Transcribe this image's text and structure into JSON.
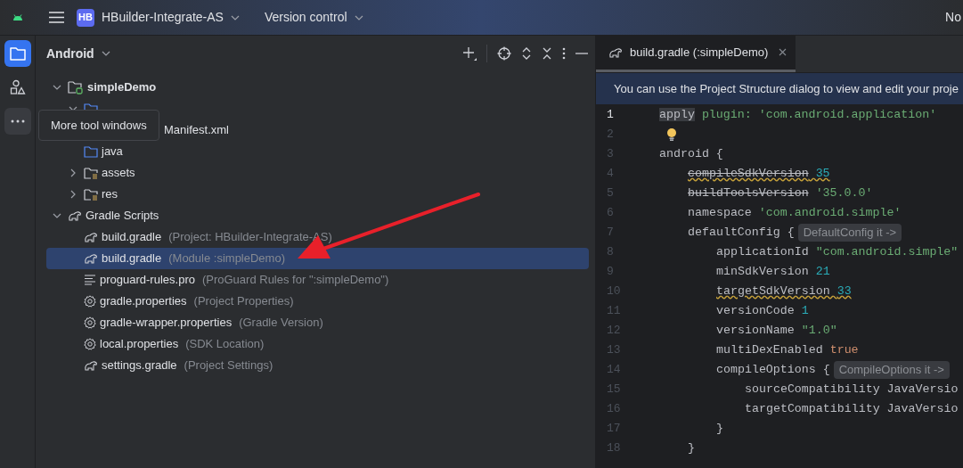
{
  "top_bar": {
    "project": {
      "badge": "HB",
      "name": "HBuilder-Integrate-AS"
    },
    "vcs": "Version control",
    "right_text": "No"
  },
  "tool_strip": [
    {
      "kind": "folder",
      "selected": true
    },
    {
      "kind": "shapes",
      "selected": false
    },
    {
      "kind": "more",
      "selected": false
    }
  ],
  "tooltip": "More tool windows",
  "project_panel": {
    "view": "Android",
    "tree": [
      {
        "label": "simpleDemo",
        "kind": "module",
        "expanded": true,
        "selected": false,
        "children": [
          {
            "kind": "folder",
            "expanded": true,
            "selected": false,
            "children": [
              {
                "label": "Manifest.xml",
                "kind": "partial",
                "selected": false
              }
            ]
          },
          {
            "label": "java",
            "kind": "folder",
            "selected": false
          },
          {
            "label": "assets",
            "kind": "resource",
            "expanded": false,
            "selected": false
          },
          {
            "label": "res",
            "kind": "resource",
            "expanded": false,
            "selected": false
          }
        ]
      },
      {
        "label": "Gradle Scripts",
        "kind": "gradle",
        "expanded": true,
        "selected": false,
        "children": [
          {
            "label": "build.gradle",
            "detail": "(Project: HBuilder-Integrate-AS)",
            "kind": "gradle",
            "selected": false
          },
          {
            "label": "build.gradle",
            "detail": "(Module :simpleDemo)",
            "kind": "gradle",
            "selected": true
          },
          {
            "label": "proguard-rules.pro",
            "detail": "(ProGuard Rules for \":simpleDemo\")",
            "kind": "text",
            "selected": false
          },
          {
            "label": "gradle.properties",
            "detail": "(Project Properties)",
            "kind": "properties",
            "selected": false
          },
          {
            "label": "gradle-wrapper.properties",
            "detail": "(Gradle Version)",
            "kind": "properties",
            "selected": false
          },
          {
            "label": "local.properties",
            "detail": "(SDK Location)",
            "kind": "properties",
            "selected": false
          },
          {
            "label": "settings.gradle",
            "detail": "(Project Settings)",
            "kind": "gradle",
            "selected": false
          }
        ]
      }
    ]
  },
  "editor": {
    "tabs": [
      {
        "label": "build.gradle (:simpleDemo)",
        "selected": true
      }
    ],
    "banner": "You can use the Project Structure dialog to view and edit your proje",
    "lines": [
      {
        "number": "1",
        "current": true,
        "tokens": [
          {
            "text": "apply",
            "kind": "highlight"
          },
          {
            "text": " plugin: 'com.android.application'",
            "kind": "string"
          }
        ]
      },
      {
        "number": "2",
        "current": false,
        "bulb": true
      },
      {
        "number": "3",
        "current": false,
        "tokens": [
          {
            "text": "android {",
            "kind": "plain"
          }
        ],
        "children": [
          {
            "number": "4",
            "current": false,
            "warning": true,
            "tokens": [
              {
                "text": "compileSdkVersion",
                "kind": "deprecated"
              },
              {
                "text": " 35",
                "kind": "number"
              }
            ]
          },
          {
            "number": "5",
            "current": false,
            "tokens": [
              {
                "text": "buildToolsVersion",
                "kind": "deprecated"
              },
              {
                "text": " '35.0.0'",
                "kind": "string"
              }
            ]
          },
          {
            "number": "6",
            "current": false,
            "tokens": [
              {
                "text": "namespace ",
                "kind": "plain"
              },
              {
                "text": "'com.android.simple'",
                "kind": "string"
              }
            ]
          },
          {
            "number": "7",
            "current": false,
            "tokens": [
              {
                "text": "defaultConfig {",
                "kind": "plain"
              },
              {
                "text": "DefaultConfig it ->",
                "kind": "hint"
              }
            ],
            "children": [
              {
                "number": "8",
                "current": false,
                "tokens": [
                  {
                    "text": "applicationId ",
                    "kind": "plain"
                  },
                  {
                    "text": "\"com.android.simple\"",
                    "kind": "string"
                  }
                ]
              },
              {
                "number": "9",
                "current": false,
                "tokens": [
                  {
                    "text": "minSdkVersion ",
                    "kind": "plain"
                  },
                  {
                    "text": "21",
                    "kind": "number"
                  }
                ]
              },
              {
                "number": "10",
                "current": false,
                "warning": true,
                "tokens": [
                  {
                    "text": "targetSdkVersion ",
                    "kind": "plain"
                  },
                  {
                    "text": "33",
                    "kind": "number"
                  }
                ]
              },
              {
                "number": "11",
                "current": false,
                "tokens": [
                  {
                    "text": "versionCode ",
                    "kind": "plain"
                  },
                  {
                    "text": "1",
                    "kind": "number"
                  }
                ]
              },
              {
                "number": "12",
                "current": false,
                "tokens": [
                  {
                    "text": "versionName ",
                    "kind": "plain"
                  },
                  {
                    "text": "\"1.0\"",
                    "kind": "string"
                  }
                ]
              },
              {
                "number": "13",
                "current": false,
                "tokens": [
                  {
                    "text": "multiDexEnabled ",
                    "kind": "plain"
                  },
                  {
                    "text": "true",
                    "kind": "keyword"
                  }
                ]
              },
              {
                "number": "14",
                "current": false,
                "tokens": [
                  {
                    "text": "compileOptions {",
                    "kind": "plain"
                  },
                  {
                    "text": "CompileOptions it ->",
                    "kind": "hint"
                  }
                ],
                "children": [
                  {
                    "number": "15",
                    "current": false,
                    "tokens": [
                      {
                        "text": "sourceCompatibility JavaVersio",
                        "kind": "plain"
                      }
                    ]
                  },
                  {
                    "number": "16",
                    "current": false,
                    "tokens": [
                      {
                        "text": "targetCompatibility JavaVersio",
                        "kind": "plain"
                      }
                    ]
                  }
                ]
              },
              {
                "number": "17",
                "current": false,
                "tokens": [
                  {
                    "text": "}",
                    "kind": "plain"
                  }
                ]
              }
            ]
          },
          {
            "number": "18",
            "current": false,
            "tokens": [
              {
                "text": "}",
                "kind": "plain"
              }
            ]
          }
        ]
      }
    ]
  }
}
